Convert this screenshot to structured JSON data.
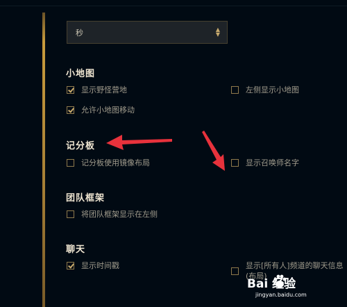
{
  "dropdown": {
    "value": "秒"
  },
  "sections": [
    {
      "title": "小地图",
      "options": [
        {
          "label": "显示野怪营地",
          "checked": true
        },
        {
          "label": "左侧显示小地图",
          "checked": false
        },
        {
          "label": "允许小地图移动",
          "checked": true
        }
      ]
    },
    {
      "title": "记分板",
      "options": [
        {
          "label": "记分板使用镜像布局",
          "checked": false
        },
        {
          "label": "显示召唤师名字",
          "checked": false
        }
      ]
    },
    {
      "title": "团队框架",
      "options": [
        {
          "label": "将团队框架显示在左侧",
          "checked": false
        }
      ]
    },
    {
      "title": "聊天",
      "options": [
        {
          "label": "显示时间戳",
          "checked": true
        },
        {
          "label": "显示[所有人]频道的聊天信息(布局)",
          "checked": false
        }
      ]
    }
  ],
  "watermark": {
    "brand": "Bai  经验",
    "sub": "jingyan.baidu.com"
  },
  "colors": {
    "background": "#010a13",
    "gold": "#c89b3c",
    "heading": "#f0e6d2",
    "annotation_arrow": "#e8323c"
  },
  "icons": [
    "chevron-updown-icon",
    "checkbox-icon",
    "red-arrow-icon",
    "baidu-paw-icon"
  ]
}
